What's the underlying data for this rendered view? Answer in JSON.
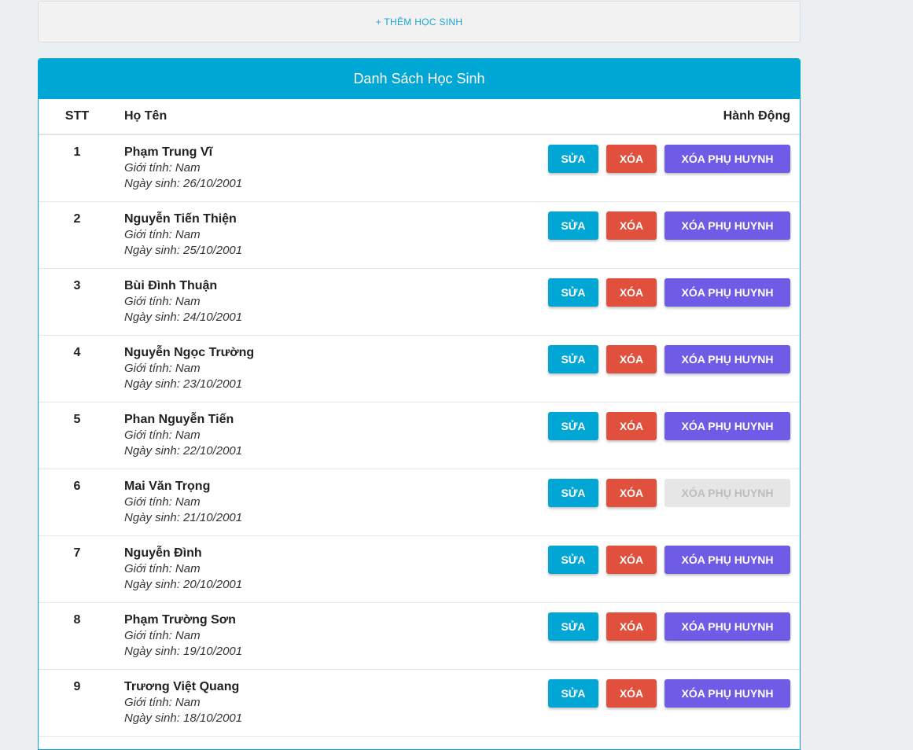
{
  "add_student_label": "+ THÊM HỌC SINH",
  "panel": {
    "title": "Danh Sách Học Sinh",
    "columns": {
      "stt": "STT",
      "name": "Họ Tên",
      "actions": "Hành Động"
    }
  },
  "buttons": {
    "edit": "SỬA",
    "delete": "XÓA",
    "delete_parent": "XÓA PHỤ HUYNH"
  },
  "students": [
    {
      "stt": "1",
      "name": "Phạm Trung Vĩ",
      "gender": "Giới tính: Nam",
      "dob": "Ngày sinh: 26/10/2001",
      "parent_enabled": true
    },
    {
      "stt": "2",
      "name": "Nguyễn Tiến Thiện",
      "gender": "Giới tính: Nam",
      "dob": "Ngày sinh: 25/10/2001",
      "parent_enabled": true
    },
    {
      "stt": "3",
      "name": "Bùi Đình Thuận",
      "gender": "Giới tính: Nam",
      "dob": "Ngày sinh: 24/10/2001",
      "parent_enabled": true
    },
    {
      "stt": "4",
      "name": "Nguyễn Ngọc Trường",
      "gender": "Giới tính: Nam",
      "dob": "Ngày sinh: 23/10/2001",
      "parent_enabled": true
    },
    {
      "stt": "5",
      "name": "Phan Nguyễn Tiến",
      "gender": "Giới tính: Nam",
      "dob": "Ngày sinh: 22/10/2001",
      "parent_enabled": true
    },
    {
      "stt": "6",
      "name": "Mai Văn Trọng",
      "gender": "Giới tính: Nam",
      "dob": "Ngày sinh: 21/10/2001",
      "parent_enabled": false
    },
    {
      "stt": "7",
      "name": "Nguyễn Đình",
      "gender": "Giới tính: Nam",
      "dob": "Ngày sinh: 20/10/2001",
      "parent_enabled": true
    },
    {
      "stt": "8",
      "name": "Phạm Trường Sơn",
      "gender": "Giới tính: Nam",
      "dob": "Ngày sinh: 19/10/2001",
      "parent_enabled": true
    },
    {
      "stt": "9",
      "name": "Trương Việt Quang",
      "gender": "Giới tính: Nam",
      "dob": "Ngày sinh: 18/10/2001",
      "parent_enabled": true
    }
  ],
  "colors": {
    "primary": "#00a6d4",
    "danger": "#e0503c",
    "parent": "#6f5ce6",
    "disabled": "#e6e6e6"
  }
}
